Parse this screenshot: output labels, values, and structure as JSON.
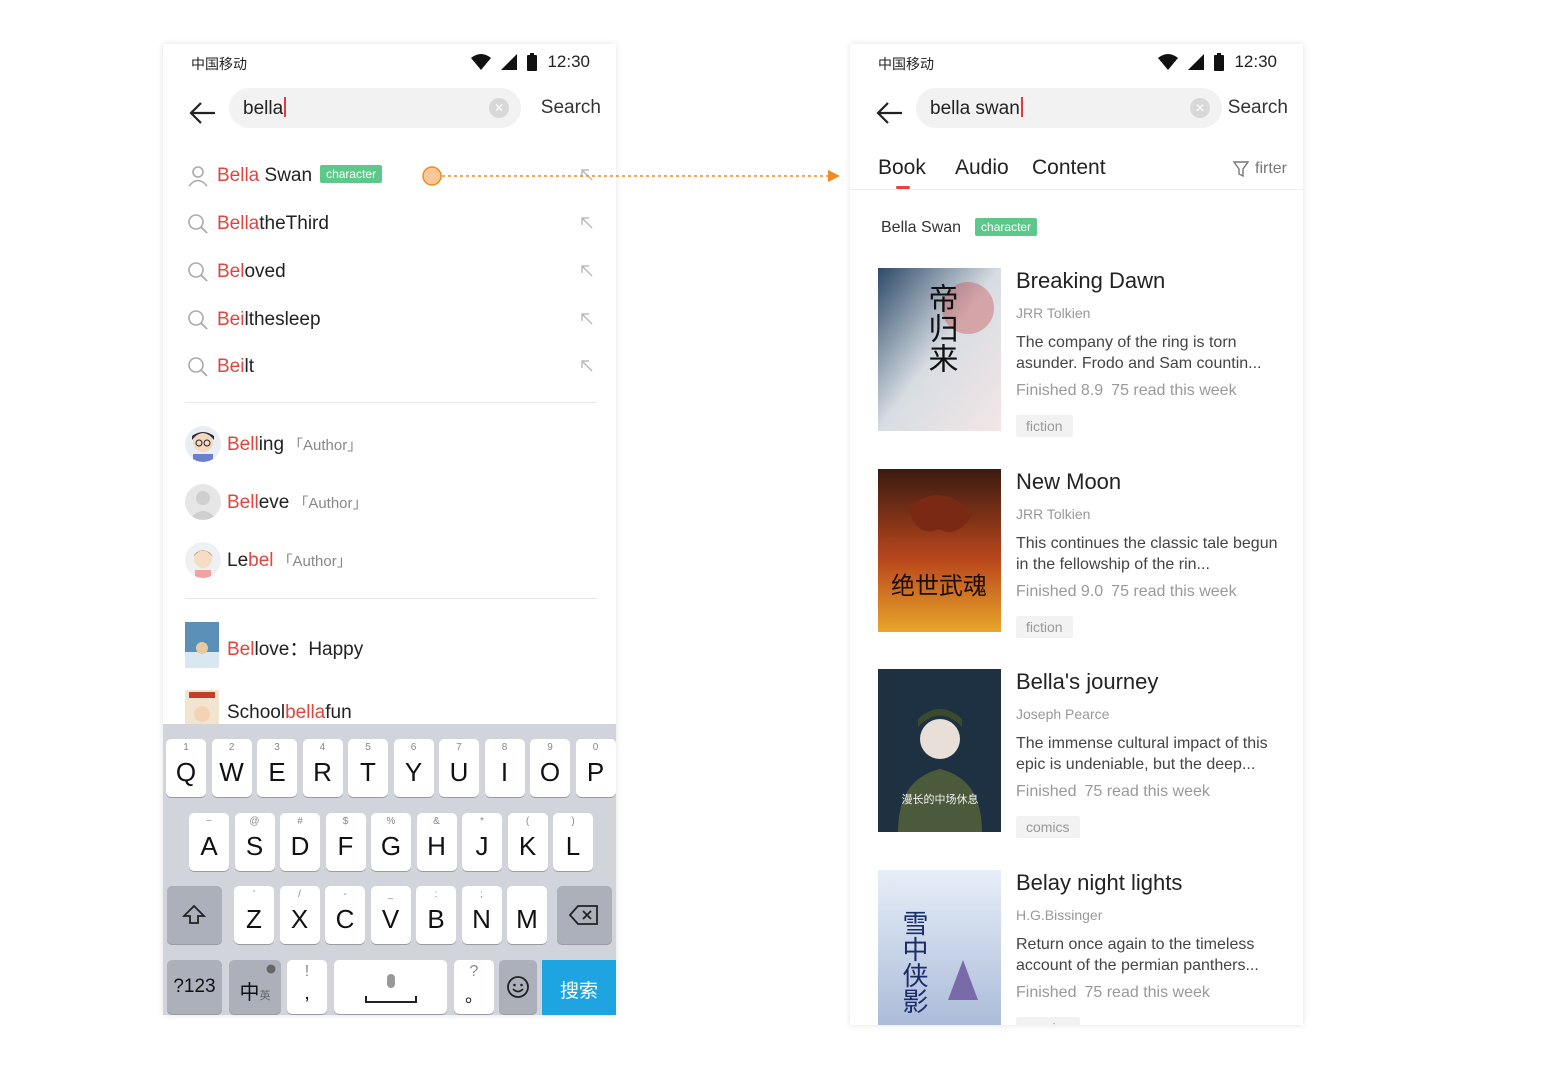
{
  "status": {
    "carrier": "中国移动",
    "time": "12:30"
  },
  "left": {
    "query": "bella",
    "search_label": "Search",
    "suggestions": [
      {
        "hl": "Bella",
        "rest": " Swan",
        "tag": "character"
      },
      {
        "hl": "Bella",
        "rest": "theThird"
      },
      {
        "hl": "Bel",
        "rest": "oved"
      },
      {
        "hl": "Bei",
        "rest": "lthesleep"
      },
      {
        "hl": "Bei",
        "rest": "lt"
      }
    ],
    "authors": [
      {
        "pre": "",
        "hl": "Bell",
        "rest": "ing",
        "role": "「Author」"
      },
      {
        "pre": "",
        "hl": "Bell",
        "rest": "eve",
        "role": "「Author」"
      },
      {
        "pre": "Le",
        "hl": "bel",
        "rest": "",
        "role": "「Author」"
      }
    ],
    "books": [
      {
        "pre": "",
        "hl": "Bel",
        "rest": "love：Happy"
      },
      {
        "pre": "School",
        "hl": "bella",
        "rest": "fun"
      }
    ],
    "keyboard": {
      "row1": [
        {
          "k": "Q",
          "n": "1"
        },
        {
          "k": "W",
          "n": "2"
        },
        {
          "k": "E",
          "n": "3"
        },
        {
          "k": "R",
          "n": "4"
        },
        {
          "k": "T",
          "n": "5"
        },
        {
          "k": "Y",
          "n": "6"
        },
        {
          "k": "U",
          "n": "7"
        },
        {
          "k": "I",
          "n": "8"
        },
        {
          "k": "O",
          "n": "9"
        },
        {
          "k": "P",
          "n": "0"
        }
      ],
      "row2": [
        {
          "k": "A",
          "n": "~"
        },
        {
          "k": "S",
          "n": "@"
        },
        {
          "k": "D",
          "n": "#"
        },
        {
          "k": "F",
          "n": "$"
        },
        {
          "k": "G",
          "n": "%"
        },
        {
          "k": "H",
          "n": "&"
        },
        {
          "k": "J",
          "n": "*"
        },
        {
          "k": "K",
          "n": "("
        },
        {
          "k": "L",
          "n": ")"
        }
      ],
      "row3": [
        {
          "k": "Z",
          "n": "'"
        },
        {
          "k": "X",
          "n": "/"
        },
        {
          "k": "C",
          "n": "-"
        },
        {
          "k": "V",
          "n": "_"
        },
        {
          "k": "B",
          "n": ":"
        },
        {
          "k": "N",
          "n": ";"
        },
        {
          "k": "M",
          "n": ""
        }
      ],
      "num_label": "?123",
      "lang_label": "中",
      "lang_sub": "英",
      "comma_top": "!",
      "comma": ",",
      "period_top": "?",
      "period": "。",
      "search_key": "搜索"
    }
  },
  "right": {
    "query": "bella swan",
    "search_label": "Search",
    "tabs": [
      "Book",
      "Audio",
      "Content"
    ],
    "filter_label": "firter",
    "character_name": "Bella Swan",
    "character_tag": "character",
    "books": [
      {
        "title": "Breaking Dawn",
        "author": "JRR Tolkien",
        "desc": "The company of the ring is torn asunder. Frodo and Sam countin...",
        "status": "Finished 8.9",
        "reads": "75 read this week",
        "genre": "fiction"
      },
      {
        "title": "New Moon",
        "author": "JRR Tolkien",
        "desc": "This continues the classic tale begun in the fellowship of the rin...",
        "status": "Finished 9.0",
        "reads": "75 read this week",
        "genre": "fiction"
      },
      {
        "title": "Bella's journey",
        "author": "Joseph Pearce",
        "desc": "The immense cultural impact of this epic is undeniable, but the deep...",
        "status": "Finished",
        "reads": "75 read this week",
        "genre": "comics"
      },
      {
        "title": "Belay night lights",
        "author": "H.G.Bissinger",
        "desc": "Return once again to the timeless account of the permian panthers...",
        "status": "Finished",
        "reads": "75 read this week",
        "genre": "comics"
      }
    ],
    "cover_texts": [
      "帝归来",
      "绝世武魂",
      "漫长的中场休息",
      "雪中侠影"
    ]
  }
}
